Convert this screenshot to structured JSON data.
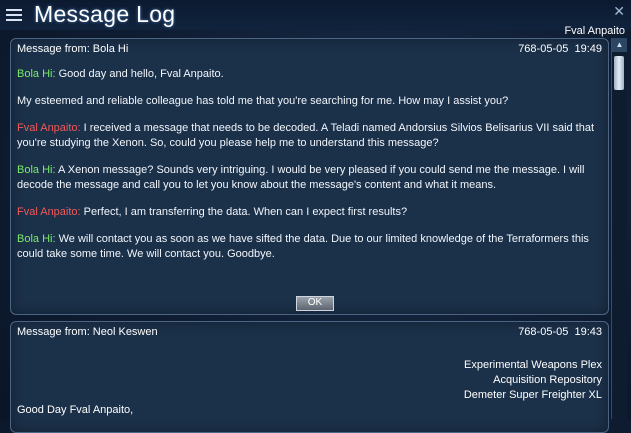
{
  "window": {
    "title": "Message Log",
    "owner": "Fval Anpaito"
  },
  "message1": {
    "from_label": "Message from: Bola Hi",
    "date": "768-05-05",
    "time": "19:49",
    "lines": [
      {
        "speaker": "Bola Hi:",
        "speaker_color": "#7be96d",
        "text": " Good day and hello, Fval Anpaito."
      },
      {
        "speaker": "",
        "speaker_color": "",
        "text": "My esteemed and reliable colleague has told me that you're searching for me. How may I assist you?"
      },
      {
        "speaker": "Fval Anpaito:",
        "speaker_color": "#f05a5a",
        "text": " I received a message that needs to be decoded. A Teladi named Andorsius Silvios Belisarius VII said that you're studying the Xenon. So, could you please help me to understand this message?"
      },
      {
        "speaker": "Bola Hi:",
        "speaker_color": "#7be96d",
        "text": " A Xenon message? Sounds very intriguing. I would be very pleased if you could send me the message. I will decode the message and call you to let you know about the message's content and what it means."
      },
      {
        "speaker": "Fval Anpaito:",
        "speaker_color": "#f05a5a",
        "text": " Perfect, I am transferring the data. When can I expect first results?"
      },
      {
        "speaker": "Bola Hi:",
        "speaker_color": "#7be96d",
        "text": " We will contact you as soon as we have sifted the data. Due to our limited knowledge of the Terraformers this could take some time. We will contact you. Goodbye."
      }
    ],
    "ok_label": "OK"
  },
  "message2": {
    "from_label": "Message from: Neol Keswen",
    "date": "768-05-05",
    "time": "19:43",
    "address": [
      "Experimental Weapons Plex",
      "Acquisition Repository",
      "Demeter Super Freighter XL"
    ],
    "greeting": "Good Day Fval Anpaito,"
  }
}
